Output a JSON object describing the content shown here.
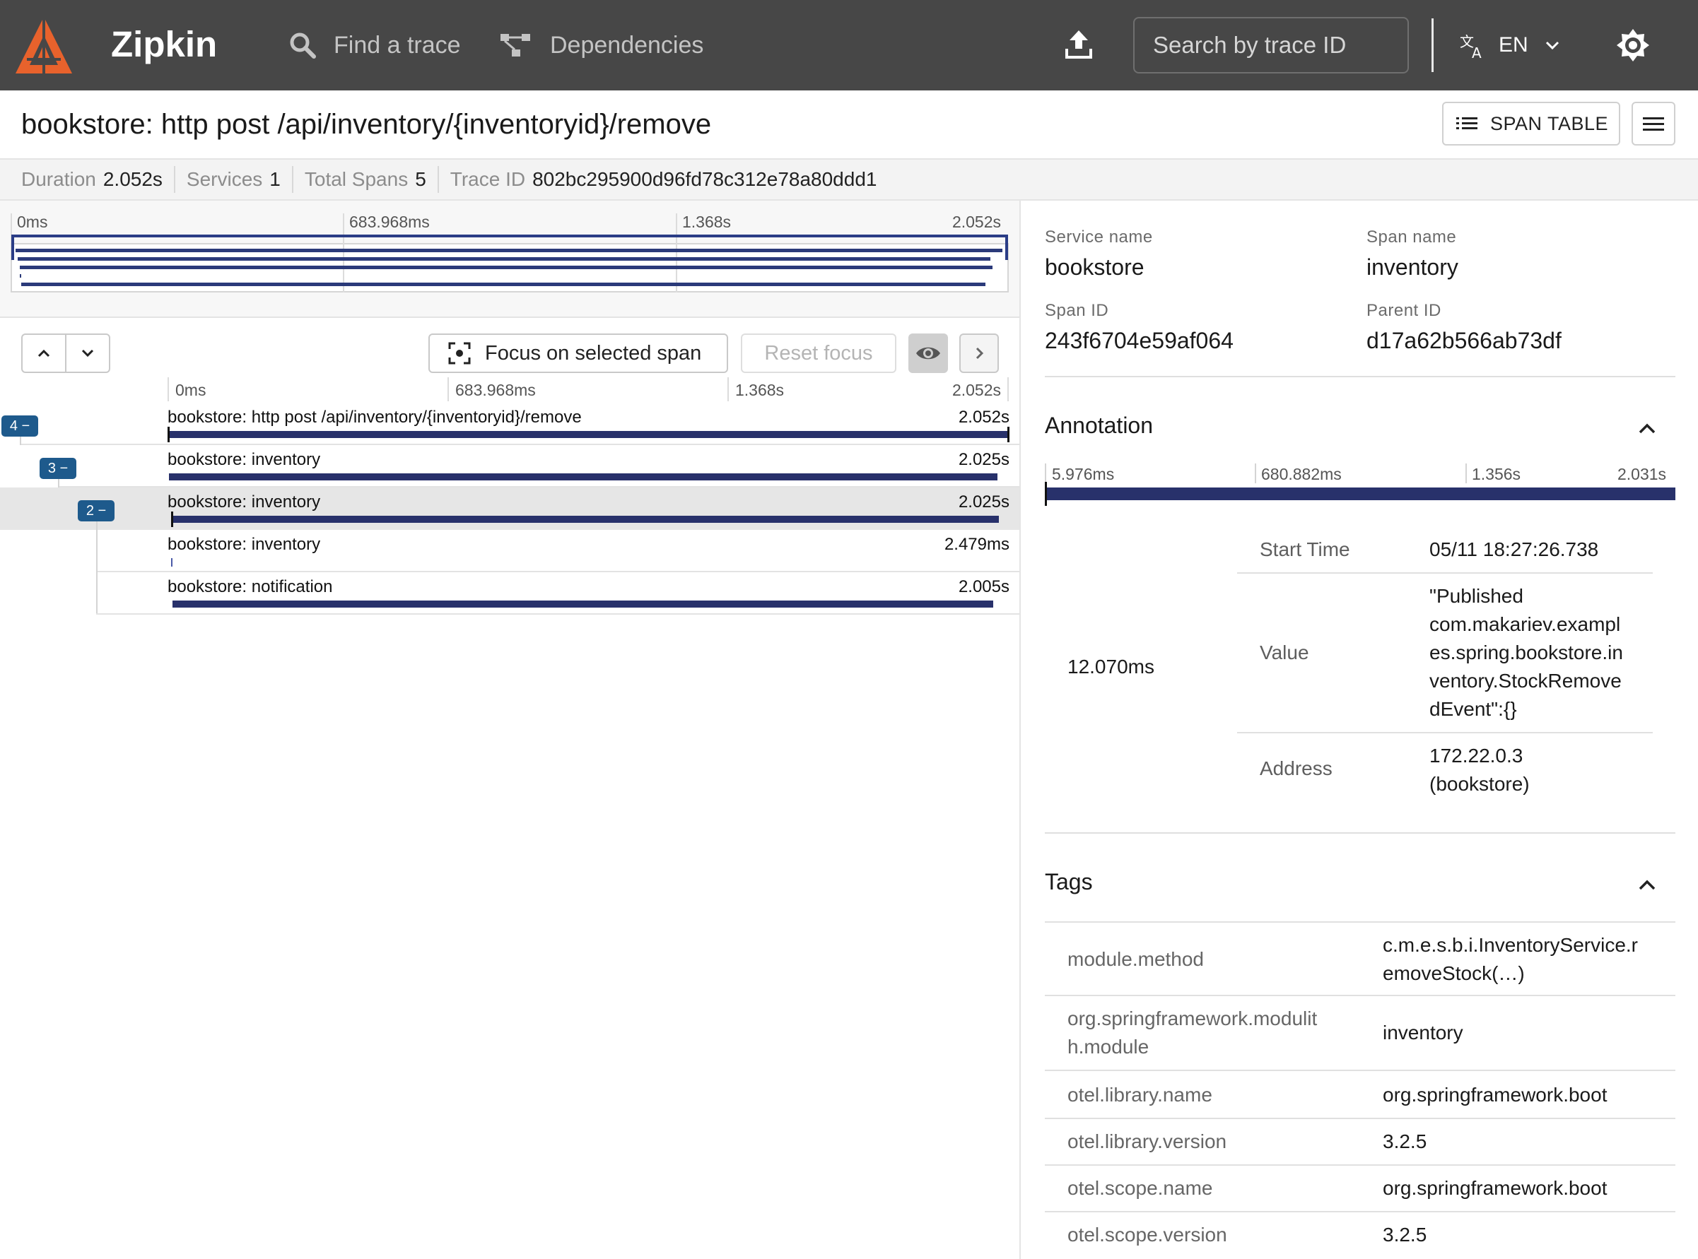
{
  "app": {
    "brand": "Zipkin",
    "nav": {
      "find_trace": "Find a trace",
      "dependencies": "Dependencies"
    },
    "search": {
      "placeholder": "Search by trace ID"
    },
    "language": "EN",
    "colors": {
      "topbar": "#474747",
      "logo": "#e8622c",
      "span_bar": "#28316b",
      "badge": "#1e5a8c"
    }
  },
  "trace": {
    "title": "bookstore: http post /api/inventory/{inventoryid}/remove",
    "span_table_label": "SPAN TABLE",
    "summary": [
      {
        "label": "Duration",
        "value": "2.052s"
      },
      {
        "label": "Services",
        "value": "1"
      },
      {
        "label": "Total Spans",
        "value": "5"
      },
      {
        "label": "Trace ID",
        "value": "802bc295900d96fd78c312e78a80ddd1"
      }
    ]
  },
  "timeline": {
    "ticks": [
      "0ms",
      "683.968ms",
      "1.368s",
      "2.052s"
    ],
    "controls": {
      "focus": "Focus on selected span",
      "reset": "Reset focus"
    },
    "spans": [
      {
        "name": "bookstore: http post /api/inventory/{inventoryid}/remove",
        "duration": "2.052s",
        "start": 0.0,
        "fraction": 1.0
      },
      {
        "name": "bookstore: inventory",
        "duration": "2.025s",
        "start": 0.002,
        "fraction": 0.986
      },
      {
        "name": "bookstore: inventory",
        "duration": "2.025s",
        "start": 0.004,
        "fraction": 0.986,
        "selected": true
      },
      {
        "name": "bookstore: inventory",
        "duration": "2.479ms",
        "start": 0.004,
        "fraction": 0.0012
      },
      {
        "name": "bookstore: notification",
        "duration": "2.005s",
        "start": 0.006,
        "fraction": 0.977
      }
    ],
    "badges": [
      "4 −",
      "3 −",
      "2 −"
    ]
  },
  "details": {
    "service_name_label": "Service name",
    "service_name": "bookstore",
    "span_name_label": "Span name",
    "span_name": "inventory",
    "span_id_label": "Span ID",
    "span_id": "243f6704e59af064",
    "parent_id_label": "Parent ID",
    "parent_id": "d17a62b566ab73df",
    "annotation_title": "Annotation",
    "annotation_ticks": [
      "5.976ms",
      "680.882ms",
      "1.356s",
      "2.031s"
    ],
    "annotation_time": "12.070ms",
    "annotation_rows": [
      {
        "label": "Start Time",
        "value": "05/11 18:27:26.738"
      },
      {
        "label": "Value",
        "value_lines": [
          "\"Published",
          "com.makariev.exampl",
          "es.spring.bookstore.in",
          "ventory.StockRemove",
          "dEvent\":{}"
        ]
      },
      {
        "label": "Address",
        "value_lines": [
          "172.22.0.3",
          "(bookstore)"
        ]
      }
    ],
    "tags_title": "Tags",
    "tags": [
      {
        "key_lines": [
          "module.method"
        ],
        "value_lines": [
          "c.m.e.s.b.i.InventoryService.r",
          "emoveStock(…)"
        ]
      },
      {
        "key_lines": [
          "org.springframework.modulit",
          "h.module"
        ],
        "value_lines": [
          "inventory"
        ]
      },
      {
        "key_lines": [
          "otel.library.name"
        ],
        "value_lines": [
          "org.springframework.boot"
        ]
      },
      {
        "key_lines": [
          "otel.library.version"
        ],
        "value_lines": [
          "3.2.5"
        ]
      },
      {
        "key_lines": [
          "otel.scope.name"
        ],
        "value_lines": [
          "org.springframework.boot"
        ]
      },
      {
        "key_lines": [
          "otel.scope.version"
        ],
        "value_lines": [
          "3.2.5"
        ]
      }
    ]
  }
}
